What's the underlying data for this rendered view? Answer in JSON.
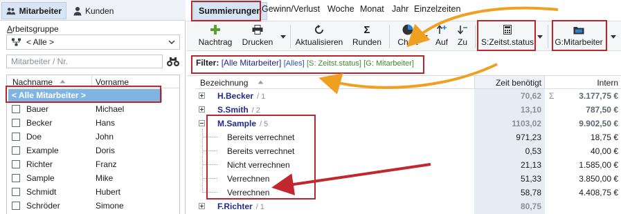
{
  "left_panel": {
    "tabs": [
      {
        "label": "Mitarbeiter",
        "active": true
      },
      {
        "label": "Kunden",
        "active": false
      }
    ],
    "group_label": "Arbeitsgruppe",
    "group_label_underline": "A",
    "group_label_rest": "rbeitsgruppe",
    "group_select_value": "< Alle >",
    "search_placeholder": "Mitarbeiter / Nr.",
    "columns": [
      "Nachname",
      "Vorname"
    ],
    "all_row": "< Alle Mitarbeiter >",
    "rows": [
      {
        "nachname": "Bauer",
        "vorname": "Michael"
      },
      {
        "nachname": "Becker",
        "vorname": "Hans"
      },
      {
        "nachname": "Doe",
        "vorname": "John"
      },
      {
        "nachname": "Example",
        "vorname": "Doris"
      },
      {
        "nachname": "Richter",
        "vorname": "Franz"
      },
      {
        "nachname": "Sample",
        "vorname": "Mike"
      },
      {
        "nachname": "Schmidt",
        "vorname": "Hubert"
      },
      {
        "nachname": "Schröder",
        "vorname": "Simone"
      }
    ]
  },
  "main_tabs": [
    "Summierungen",
    "Gewinn/Verlust",
    "Woche",
    "Monat",
    "Jahr",
    "Einzelzeiten"
  ],
  "toolbar": {
    "nachtrag": "Nachtrag",
    "drucken": "Drucken",
    "aktualisieren": "Aktualisieren",
    "runden": "Runden",
    "chart": "Chart",
    "auf": "Auf",
    "zu": "Zu",
    "s_zeitst": "S:Zeitst.status",
    "g_mitarbeiter": "G:Mitarbeiter"
  },
  "filter": {
    "label": "Filter:",
    "main": "[Alle Mitarbeiter]",
    "alles": "[Alles]",
    "status": "[S: Zeitst.status]",
    "gruppe": "[G: Mitarbeiter]"
  },
  "grid": {
    "columns": {
      "bezeichnung": "Bezeichnung",
      "zeit": "Zeit benötigt",
      "intern": "Intern"
    },
    "sigma": "Σ",
    "rows": [
      {
        "type": "group",
        "expanded": false,
        "name": "H.Becker",
        "count": "/ 1",
        "zeit": "70,62",
        "intern": "3.177,75 €",
        "sigma": true
      },
      {
        "type": "group",
        "expanded": false,
        "name": "S.Smith",
        "count": "/ 2",
        "zeit": "13,10",
        "intern": "787,50 €"
      },
      {
        "type": "group",
        "expanded": true,
        "name": "M.Sample",
        "count": "/ 5",
        "zeit": "1103,02",
        "intern": "9.902,50 €"
      },
      {
        "type": "item",
        "name": "Bereits verrechnet",
        "zeit": "971,23",
        "intern": "18,75 €"
      },
      {
        "type": "item",
        "name": "Bereits verrechnet",
        "zeit": "0,53",
        "intern": "40,00 €"
      },
      {
        "type": "item",
        "name": "Nicht verrechnen",
        "zeit": "21,13",
        "intern": "1.585,00 €"
      },
      {
        "type": "item",
        "name": "Verrechnen",
        "zeit": "51,33",
        "intern": "3.850,00 €"
      },
      {
        "type": "item",
        "name": "Verrechnen",
        "zeit": "58,78",
        "intern": "4.408,75 €"
      },
      {
        "type": "group",
        "expanded": false,
        "name": "F.Richter",
        "count": "/ 1",
        "zeit": "80,75",
        "intern": ""
      }
    ]
  },
  "colors": {
    "highlight_box": "#b8252a",
    "arrow": "#f0a020",
    "selection": "#7fb4e5",
    "group_text": "#1f2a8f"
  }
}
